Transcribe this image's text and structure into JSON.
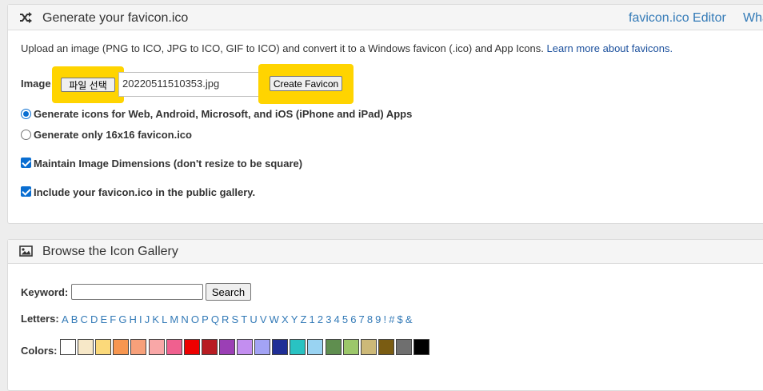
{
  "generate_panel": {
    "title": "Generate your favicon.ico",
    "icon": "shuffle-icon",
    "links": [
      "favicon.ico Editor",
      "Wha"
    ],
    "description": "Upload an image (PNG to ICO, JPG to ICO, GIF to ICO) and convert it to a Windows favicon (.ico) and App Icons.",
    "description_link": "Learn more about favicons.",
    "image_label": "Image",
    "choose_file_label": "파일 선택",
    "file_name": "20220511510353.jpg",
    "create_button": "Create Favicon",
    "highlight_color": "#ffd400",
    "options": {
      "radio_all": "Generate icons for Web, Android, Microsoft, and iOS (iPhone and iPad) Apps",
      "radio_16": "Generate only 16x16 favicon.ico",
      "check_dimensions": "Maintain Image Dimensions (don't resize to be square)",
      "check_gallery": "Include your favicon.ico in the public gallery."
    }
  },
  "gallery_panel": {
    "title": "Browse the Icon Gallery",
    "icon": "image-icon",
    "keyword_label": "Keyword:",
    "keyword_value": "",
    "search_button": "Search",
    "letters_label": "Letters:",
    "letters": [
      "A",
      "B",
      "C",
      "D",
      "E",
      "F",
      "G",
      "H",
      "I",
      "J",
      "K",
      "L",
      "M",
      "N",
      "O",
      "P",
      "Q",
      "R",
      "S",
      "T",
      "U",
      "V",
      "W",
      "X",
      "Y",
      "Z",
      "1",
      "2",
      "3",
      "4",
      "5",
      "6",
      "7",
      "8",
      "9",
      "!",
      "#",
      "$",
      "&"
    ],
    "colors_label": "Colors:",
    "colors": [
      "#ffffff",
      "#f7e8c8",
      "#fbd97a",
      "#f79650",
      "#f7a07a",
      "#f9a7a7",
      "#f0608f",
      "#ee0000",
      "#b81c22",
      "#9b3fb5",
      "#c38ef0",
      "#a3a3f5",
      "#1f2e96",
      "#29c2c2",
      "#99d3f2",
      "#5f8e4f",
      "#9cc76a",
      "#cdb978",
      "#7a5c12",
      "#6f6f6f",
      "#000000"
    ]
  }
}
